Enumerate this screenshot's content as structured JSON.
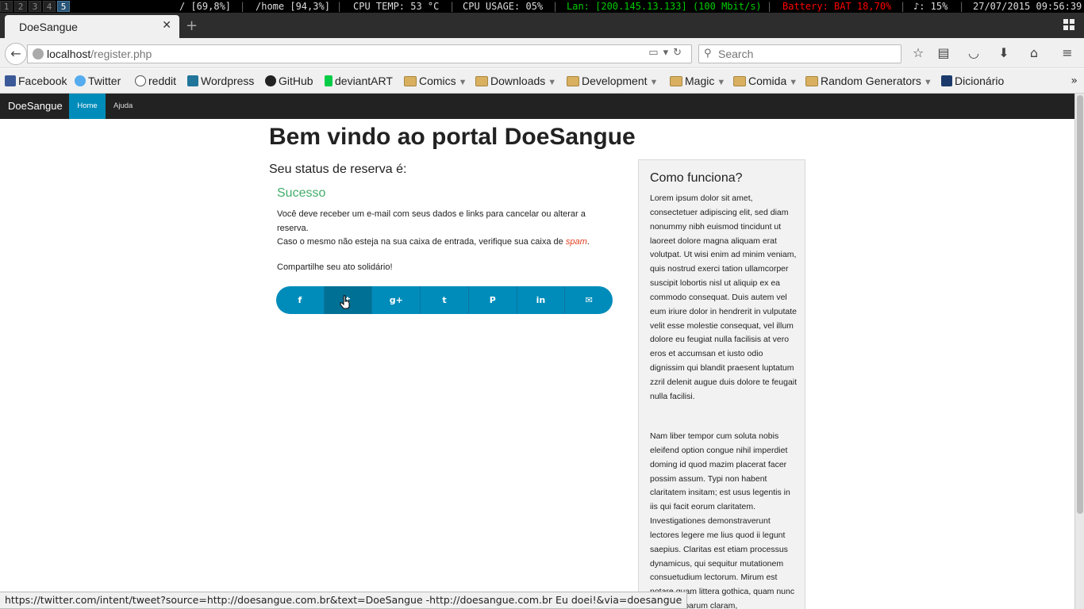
{
  "statusbar": {
    "workspaces": [
      "1",
      "2",
      "3",
      "4",
      "5"
    ],
    "active_workspace": "5",
    "disk_root": "/ [69,8%]",
    "disk_home": "/home [94,3%]",
    "cpu_temp": "CPU TEMP: 53 °C",
    "cpu_usage": "CPU USAGE: 05%",
    "lan": "Lan: [200.145.13.133] (100 Mbit/s)",
    "battery": "Battery: BAT 18,70%",
    "volume": "♪: 15%",
    "datetime": "27/07/2015 09:56:39",
    "colors": {
      "lan": "#00cc00",
      "battery": "#ff0000"
    }
  },
  "browser": {
    "tab_title": "DoeSangue",
    "new_tab": "+",
    "url_host": "localhost",
    "url_path": "/register.php",
    "search_placeholder": "Search",
    "bookmarks": [
      {
        "label": "Facebook",
        "icon": "facebook-icon"
      },
      {
        "label": "Twitter",
        "icon": "twitter-icon"
      },
      {
        "label": "reddit",
        "icon": "reddit-icon"
      },
      {
        "label": "Wordpress",
        "icon": "wordpress-icon"
      },
      {
        "label": "GitHub",
        "icon": "github-icon"
      },
      {
        "label": "deviantART",
        "icon": "deviantart-icon"
      },
      {
        "label": "Comics",
        "icon": "folder-icon"
      },
      {
        "label": "Downloads",
        "icon": "folder-icon"
      },
      {
        "label": "Development",
        "icon": "folder-icon"
      },
      {
        "label": "Magic",
        "icon": "folder-icon"
      },
      {
        "label": "Comida",
        "icon": "folder-icon"
      },
      {
        "label": "Random Generators",
        "icon": "folder-icon"
      },
      {
        "label": "Dicionário",
        "icon": "dicionario-icon"
      }
    ],
    "link_status": "https://twitter.com/intent/tweet?source=http://doesangue.com.br&text=DoeSangue -http://doesangue.com.br Eu doei!&via=doesangue"
  },
  "site": {
    "brand": "DoeSangue",
    "nav": {
      "home": "Home",
      "help": "Ajuda"
    },
    "accent_color": "#008cba",
    "heading": "Bem vindo ao portal DoeSangue",
    "subheading": "Seu status de reserva é:",
    "success_title": "Sucesso",
    "success_color": "#43ac6a",
    "message_line1": "Você deve receber um e-mail com seus dados e links para cancelar ou alterar a reserva.",
    "message_line2_before": "Caso o mesmo não esteja na sua caixa de entrada, verifique sua caixa de ",
    "message_spam": "spam",
    "message_line2_after": ".",
    "share_label": "Compartilhe seu ato solidário!",
    "share_buttons": [
      {
        "icon": "facebook-icon",
        "glyph": "f"
      },
      {
        "icon": "twitter-icon",
        "glyph": "t"
      },
      {
        "icon": "google-plus-icon",
        "glyph": "g+"
      },
      {
        "icon": "tumblr-icon",
        "glyph": "t"
      },
      {
        "icon": "pinterest-icon",
        "glyph": "P"
      },
      {
        "icon": "linkedin-icon",
        "glyph": "in"
      },
      {
        "icon": "email-icon",
        "glyph": "✉"
      }
    ],
    "panel": {
      "title": "Como funciona?",
      "paragraph1": "Lorem ipsum dolor sit amet, consectetuer adipiscing elit, sed diam nonummy nibh euismod tincidunt ut laoreet dolore magna aliquam erat volutpat. Ut wisi enim ad minim veniam, quis nostrud exerci tation ullamcorper suscipit lobortis nisl ut aliquip ex ea commodo consequat. Duis autem vel eum iriure dolor in hendrerit in vulputate velit esse molestie consequat, vel illum dolore eu feugiat nulla facilisis at vero eros et accumsan et iusto odio dignissim qui blandit praesent luptatum zzril delenit augue duis dolore te feugait nulla facilisi.",
      "paragraph2": "Nam liber tempor cum soluta nobis eleifend option congue nihil imperdiet doming id quod mazim placerat facer possim assum. Typi non habent claritatem insitam; est usus legentis in iis qui facit eorum claritatem. Investigationes demonstraverunt lectores legere me lius quod ii legunt saepius. Claritas est etiam processus dynamicus, qui sequitur mutationem consuetudium lectorum. Mirum est notare quam littera gothica, quam nunc putamus parum claram,"
    }
  }
}
